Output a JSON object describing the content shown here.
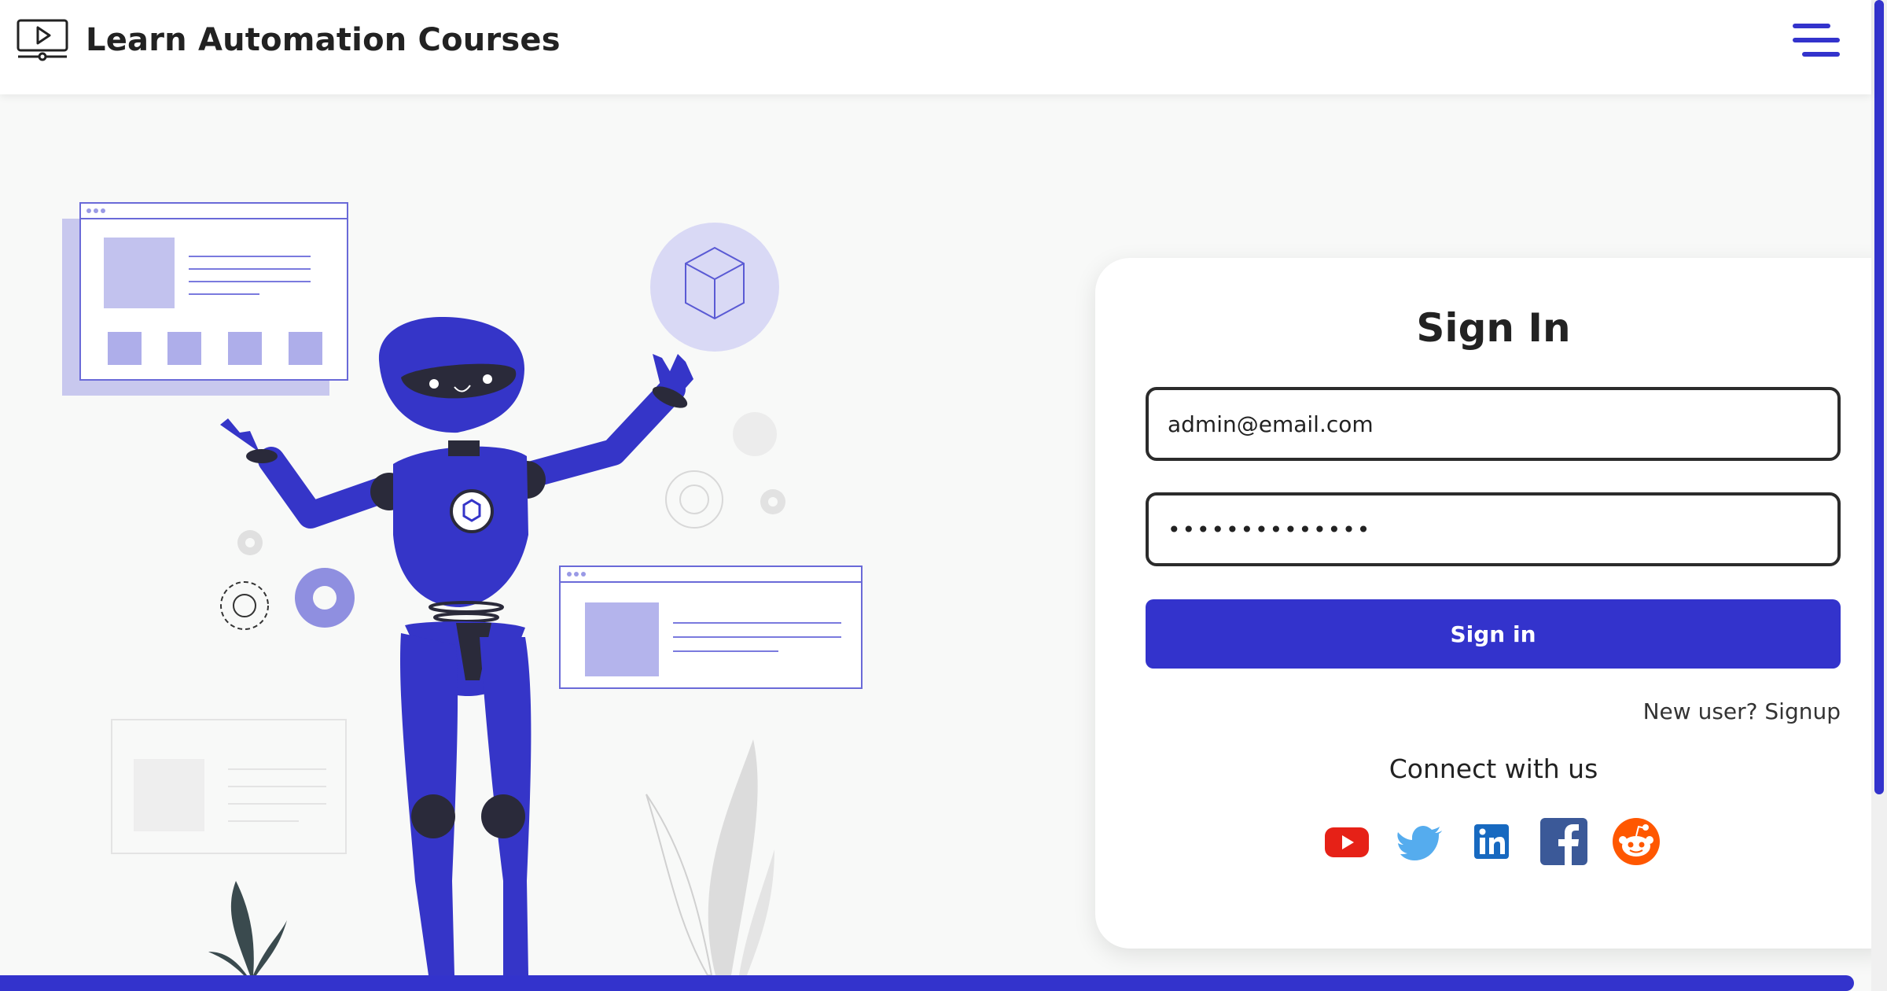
{
  "navbar": {
    "brand_icon": "video-monitor-icon",
    "brand_text": "Learn Automation Courses",
    "menu_icon": "hamburger-menu-icon"
  },
  "hero": {
    "illustration": "robot-illustration"
  },
  "signin": {
    "title": "Sign In",
    "email_value": "admin@email.com",
    "password_value": "••••••••••••••",
    "button_label": "Sign in",
    "signup_text": "New user? Signup",
    "connect_title": "Connect with us",
    "socials": [
      {
        "name": "youtube-icon",
        "color": "#e62117"
      },
      {
        "name": "twitter-icon",
        "color": "#55acee"
      },
      {
        "name": "linkedin-icon",
        "color": "#1769c0"
      },
      {
        "name": "facebook-icon",
        "color": "#3b5998"
      },
      {
        "name": "reddit-icon",
        "color": "#ff5700"
      }
    ]
  },
  "colors": {
    "accent": "#3333cc",
    "robot": "#3535c8",
    "text": "#222222",
    "background": "#f8f9f8"
  }
}
